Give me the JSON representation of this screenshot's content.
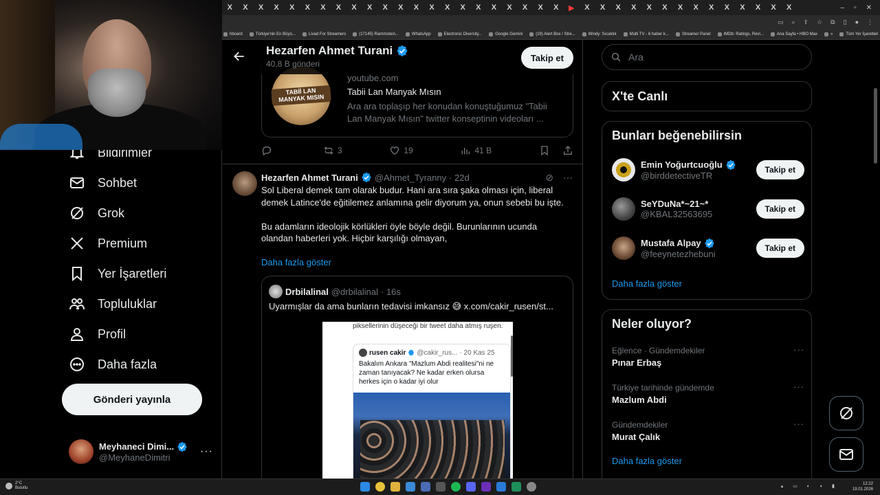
{
  "colors": {
    "bg": "#000000",
    "border": "#2f3336",
    "text": "#e7e9ea",
    "muted": "#71767b",
    "blue": "#1d9bf0",
    "button": "#eff3f4",
    "verified": "#1d9bf0"
  },
  "browser": {
    "tab_glyph": "X",
    "bookmarks": [
      "hboard",
      "Türkiye'nin En Büyü...",
      "Livad For Streamers",
      "(17145) Rammstein...",
      "WhatsApp",
      "Electronic Diversity...",
      "Google Gemini",
      "(19) Alert Box / Stre...",
      "Windy: Sıcaklık",
      "Multi TV - 6 haber k...",
      "Streamer Panel",
      "IMDb: Ratings, Revi...",
      "Ana Sayfa • HBO Max",
      "»",
      "Tüm Yer İşaretleri"
    ]
  },
  "nav": {
    "items": [
      {
        "label": "Bildirimler",
        "icon": "bell-icon"
      },
      {
        "label": "Sohbet",
        "icon": "mail-icon"
      },
      {
        "label": "Grok",
        "icon": "grok-icon"
      },
      {
        "label": "Premium",
        "icon": "x-logo-icon"
      },
      {
        "label": "Yer İşaretleri",
        "icon": "bookmark-icon"
      },
      {
        "label": "Topluluklar",
        "icon": "communities-icon"
      },
      {
        "label": "Profil",
        "icon": "person-icon"
      },
      {
        "label": "Daha fazla",
        "icon": "more-circle-icon"
      }
    ],
    "post_button": "Gönderi yayınla",
    "account": {
      "display_name": "Meyhaneci Dimi...",
      "username": "@MeyhaneDimitri",
      "more": "···"
    }
  },
  "profile_header": {
    "name": "Hezarfen Ahmet Turani",
    "post_count": "40,8 B gönderi",
    "follow_label": "Takip et"
  },
  "link_card": {
    "thumb_text": "TABİİ LAN MANYAK MISIN",
    "domain": "youtube.com",
    "title": "Tabii Lan Manyak Mısın",
    "description": "Ara ara toplaşıp her konudan konuştuğumuz \"Tabii Lan Manyak Mısın\" twitter konseptinin videoları ..."
  },
  "first_actions": {
    "replies": "",
    "reposts": "3",
    "likes": "19",
    "views": "41 B"
  },
  "tweet": {
    "name": "Hezarfen Ahmet Turani",
    "handle": "@Ahmet_Tyranny",
    "time": "· 22d",
    "paragraph1": "Sol Liberal demek tam olarak budur. Hani ara sıra şaka olması için, liberal demek Latince'de eğitilemez anlamına gelir diyorum ya, onun sebebi bu işte.",
    "paragraph2": "Bu adamların ideolojik körlükleri öyle böyle değil. Burunlarının ucunda olandan haberleri yok. Hiçbir karşılığı olmayan,",
    "show_more": "Daha fazla göster"
  },
  "quote": {
    "name": "Drbilalinal",
    "handle": "@drbilalinal",
    "time": "· 16s",
    "text": "Uyarmışlar da ama bunların tedavisi imkansız 😅  x.com/cakir_rusen/st...",
    "image": {
      "top_text": "piksellerinin düşeceği bir tweet daha atmış ruşen.",
      "inner_name": "rusen cakir",
      "inner_handle": "@cakir_rus...",
      "inner_time": "· 20 Kas 25",
      "inner_text": "Bakalım Ankara \"Mazlum Abdi realitesi\"ni ne zaman tanıyacak? Ne kadar erken olursa herkes için o kadar iyi olur"
    }
  },
  "search": {
    "placeholder": "Ara"
  },
  "live": {
    "title": "X'te Canlı"
  },
  "who_to_follow": {
    "title": "Bunları beğenebilirsin",
    "users": [
      {
        "name": "Emin Yoğurtcuoğlu",
        "handle": "@birddetectiveTR",
        "verified": true,
        "button": "Takip et",
        "avatar_color": "#c9a21b"
      },
      {
        "name": "SeYDuNa*~21~*",
        "handle": "@KBAL32563695",
        "verified": false,
        "button": "Takip et",
        "avatar_color": "#6a6a6a"
      },
      {
        "name": "Mustafa Alpay",
        "handle": "@feeynetezhebuni",
        "verified": true,
        "button": "Takip et",
        "avatar_color": "#8a6a4a"
      }
    ],
    "show_more": "Daha fazla göster"
  },
  "trends": {
    "title": "Neler oluyor?",
    "items": [
      {
        "category": "Eğlence · Gündemdekiler",
        "topic": "Pınar Erbaş"
      },
      {
        "category": "Türkiye tarihinde gündemde",
        "topic": "Mazlum Abdi"
      },
      {
        "category": "Gündemdekiler",
        "topic": "Murat Çalık"
      }
    ],
    "show_more": "Daha fazla göster"
  },
  "taskbar": {
    "temp": "2°C",
    "weather": "Bulutlu",
    "time": "12:22",
    "date": "19.01.2026"
  }
}
